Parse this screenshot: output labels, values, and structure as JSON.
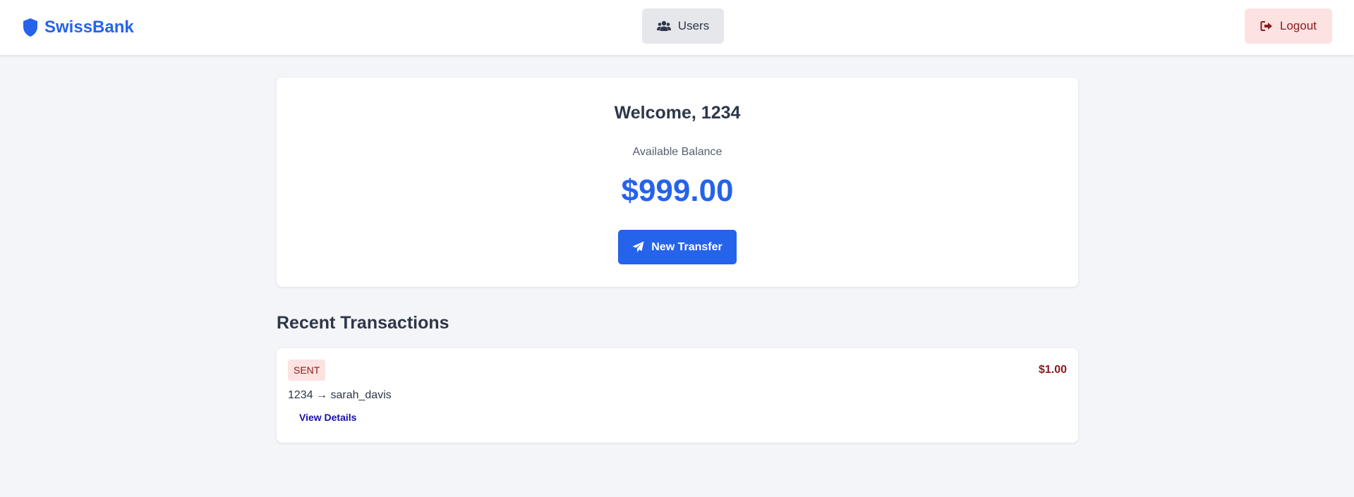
{
  "app": {
    "brand_name": "SwissBank",
    "brand_color": "#2563eb"
  },
  "nav": {
    "users_label": "Users",
    "users_icon": "users-icon",
    "logout_label": "Logout",
    "logout_icon": "sign-out-icon"
  },
  "dashboard": {
    "welcome_text": "Welcome, 1234",
    "balance_label": "Available Balance",
    "balance_amount": "$999.00",
    "transfer_label": "New Transfer",
    "transfer_icon": "paper-plane-icon"
  },
  "transactions": {
    "section_title": "Recent Transactions",
    "items": [
      {
        "type": "SENT",
        "amount": "$1.00",
        "parties": "1234 → sarah_davis",
        "details_label": "View Details"
      }
    ]
  },
  "colors": {
    "accent": "#2563eb",
    "sent": "#8b1a1a",
    "sent_bg": "#fde2e2",
    "link": "#1a0dab"
  }
}
